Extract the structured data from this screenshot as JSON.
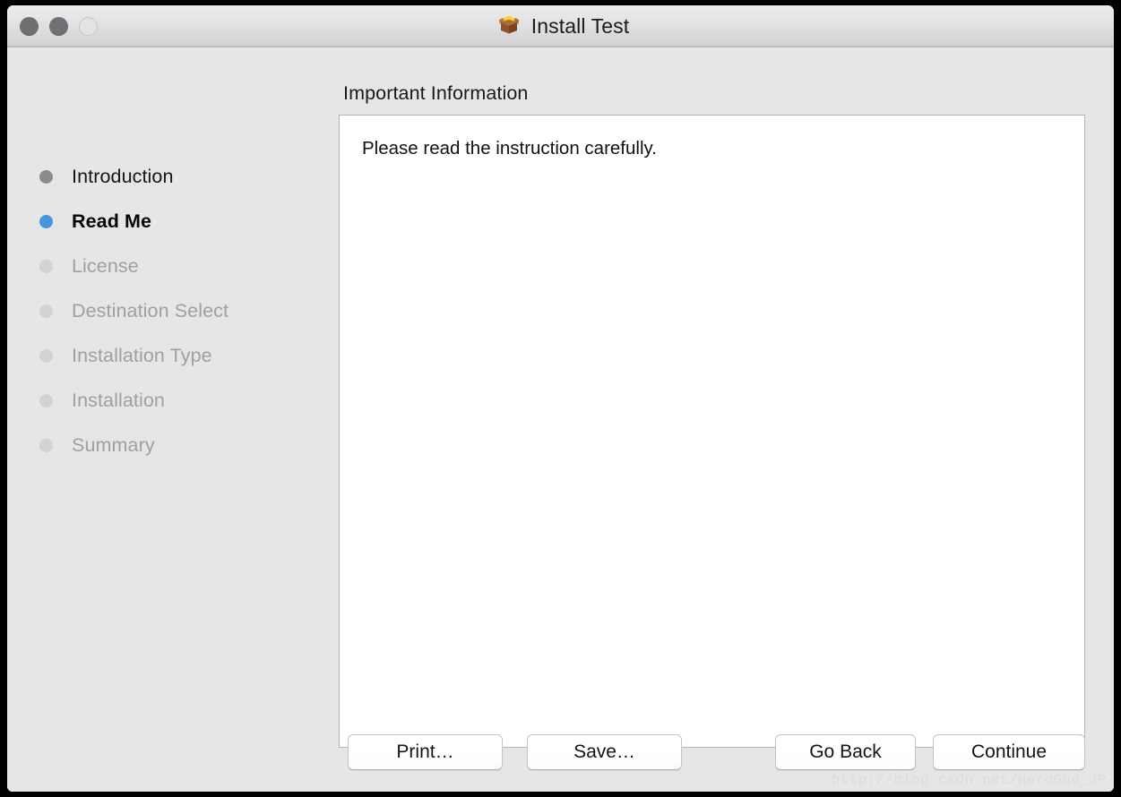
{
  "window": {
    "title": "Install Test",
    "icon": "package-box-icon",
    "controls": {
      "close": "close-button",
      "minimize": "minimize-button",
      "zoom": "zoom-button"
    }
  },
  "sidebar": {
    "items": [
      {
        "label": "Introduction",
        "state": "done",
        "bullet_color": "#8b8b8b"
      },
      {
        "label": "Read Me",
        "state": "current",
        "bullet_color": "#4a95e2"
      },
      {
        "label": "License",
        "state": "pending",
        "bullet_color": "#d2d2d2"
      },
      {
        "label": "Destination Select",
        "state": "pending",
        "bullet_color": "#d2d2d2"
      },
      {
        "label": "Installation Type",
        "state": "pending",
        "bullet_color": "#d2d2d2"
      },
      {
        "label": "Installation",
        "state": "pending",
        "bullet_color": "#d2d2d2"
      },
      {
        "label": "Summary",
        "state": "pending",
        "bullet_color": "#d2d2d2"
      }
    ]
  },
  "main": {
    "heading": "Important Information",
    "readme_text": "Please read the instruction carefully."
  },
  "buttons": {
    "print": "Print…",
    "save": "Save…",
    "go_back": "Go Back",
    "continue": "Continue"
  },
  "watermark": {
    "text": "http://blog.csdn.net/HeroGuo_JP"
  },
  "colors": {
    "accent": "#4a95e2",
    "window_bg": "#e6e6e6",
    "pane_bg": "#ffffff",
    "titlebar_top": "#ececec",
    "titlebar_bottom": "#d2d2d2"
  }
}
